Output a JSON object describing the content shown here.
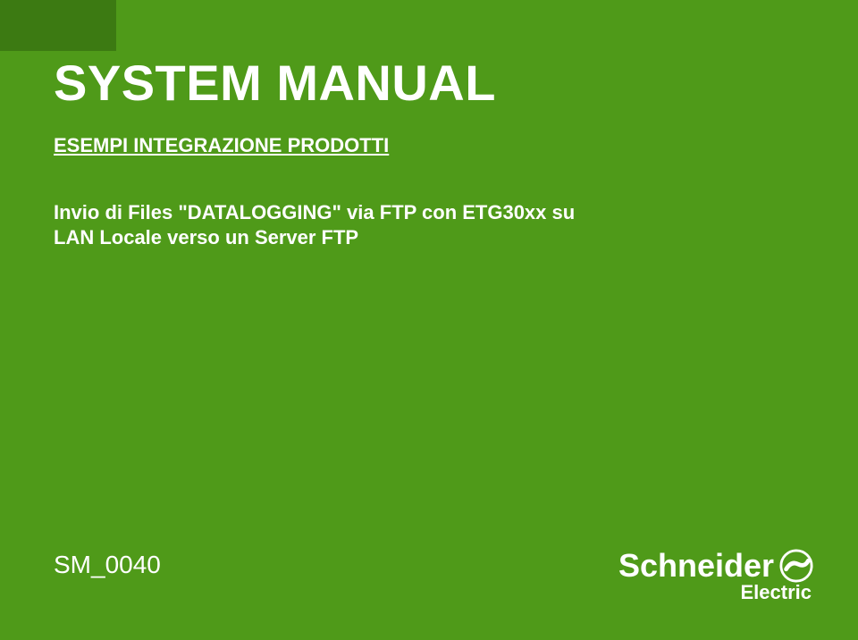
{
  "title": "SYSTEM MANUAL",
  "subtitle": "ESEMPI INTEGRAZIONE PRODOTTI",
  "body_line1": "Invio di Files \"DATALOGGING\" via FTP con ETG30xx su",
  "body_line2": "LAN Locale verso un Server FTP",
  "doc_code": "SM_0040",
  "brand": {
    "name": "Schneider",
    "sub": "Electric"
  },
  "colors": {
    "bg": "#4f9a19",
    "accent": "#3c7a12",
    "text": "#ffffff"
  }
}
